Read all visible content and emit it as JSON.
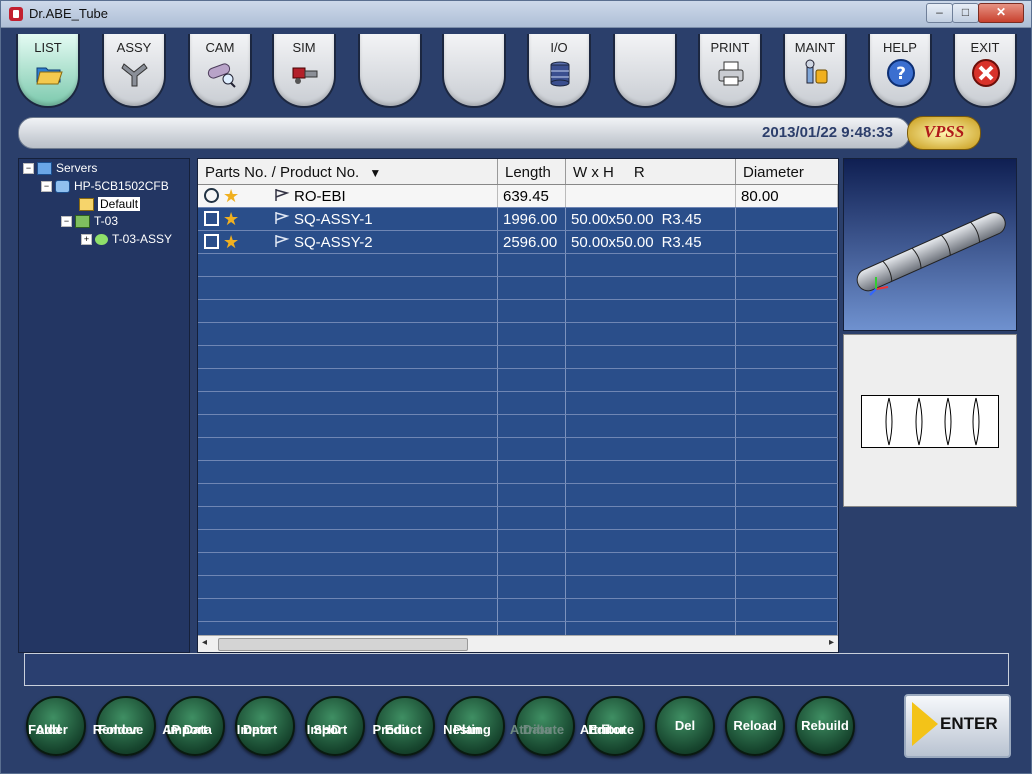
{
  "window": {
    "title": "Dr.ABE_Tube",
    "minimize": "–",
    "maximize": "□",
    "close": "✕"
  },
  "tabs": [
    {
      "label": "LIST"
    },
    {
      "label": "ASSY"
    },
    {
      "label": "CAM"
    },
    {
      "label": "SIM"
    },
    {
      "label": ""
    },
    {
      "label": ""
    },
    {
      "label": "I/O"
    },
    {
      "label": ""
    },
    {
      "label": "PRINT"
    },
    {
      "label": "MAINT"
    },
    {
      "label": "HELP"
    },
    {
      "label": "EXIT"
    }
  ],
  "status": {
    "datetime": "2013/01/22 9:48:33",
    "logo_text": "VPSS"
  },
  "tree": {
    "root": "Servers",
    "host": "HP-5CB1502CFB",
    "default_folder": "Default",
    "folder": "T-03",
    "assy": "T-03-ASSY"
  },
  "grid": {
    "headers": {
      "parts": "Parts No. / Product No.",
      "sort_mark": "▼",
      "length": "Length",
      "wxh": "W x H",
      "r": "R",
      "diameter": "Diameter"
    },
    "rows": [
      {
        "name": "RO-EBI",
        "length": "639.45",
        "wxh": "",
        "r": "",
        "diameter": "80.00"
      },
      {
        "name": "SQ-ASSY-1",
        "length": "1996.00",
        "wxh": "50.00x50.00",
        "r": "R3.45",
        "diameter": ""
      },
      {
        "name": "SQ-ASSY-2",
        "length": "2596.00",
        "wxh": "50.00x50.00",
        "r": "R3.45",
        "diameter": ""
      }
    ]
  },
  "scroll": {
    "left": "◂",
    "right": "▸"
  },
  "buttons": [
    {
      "l1": "Add",
      "l2": "Folder"
    },
    {
      "l1": "Remove",
      "l2": "Folder"
    },
    {
      "l1": "AP Data",
      "l2": "Import"
    },
    {
      "l1": "Data",
      "l2": "Import"
    },
    {
      "l1": "SHD",
      "l2": "Import"
    },
    {
      "l1": "Product",
      "l2": "Edit"
    },
    {
      "l1": "Nesting",
      "l2": "Plan"
    },
    {
      "l1": "Attribute",
      "l2": "Data"
    },
    {
      "l1": "Attribute",
      "l2": "Editor"
    },
    {
      "l1": "Del",
      "l2": ""
    },
    {
      "l1": "Reload",
      "l2": ""
    },
    {
      "l1": "Rebuild",
      "l2": ""
    }
  ],
  "enter_label": "ENTER"
}
